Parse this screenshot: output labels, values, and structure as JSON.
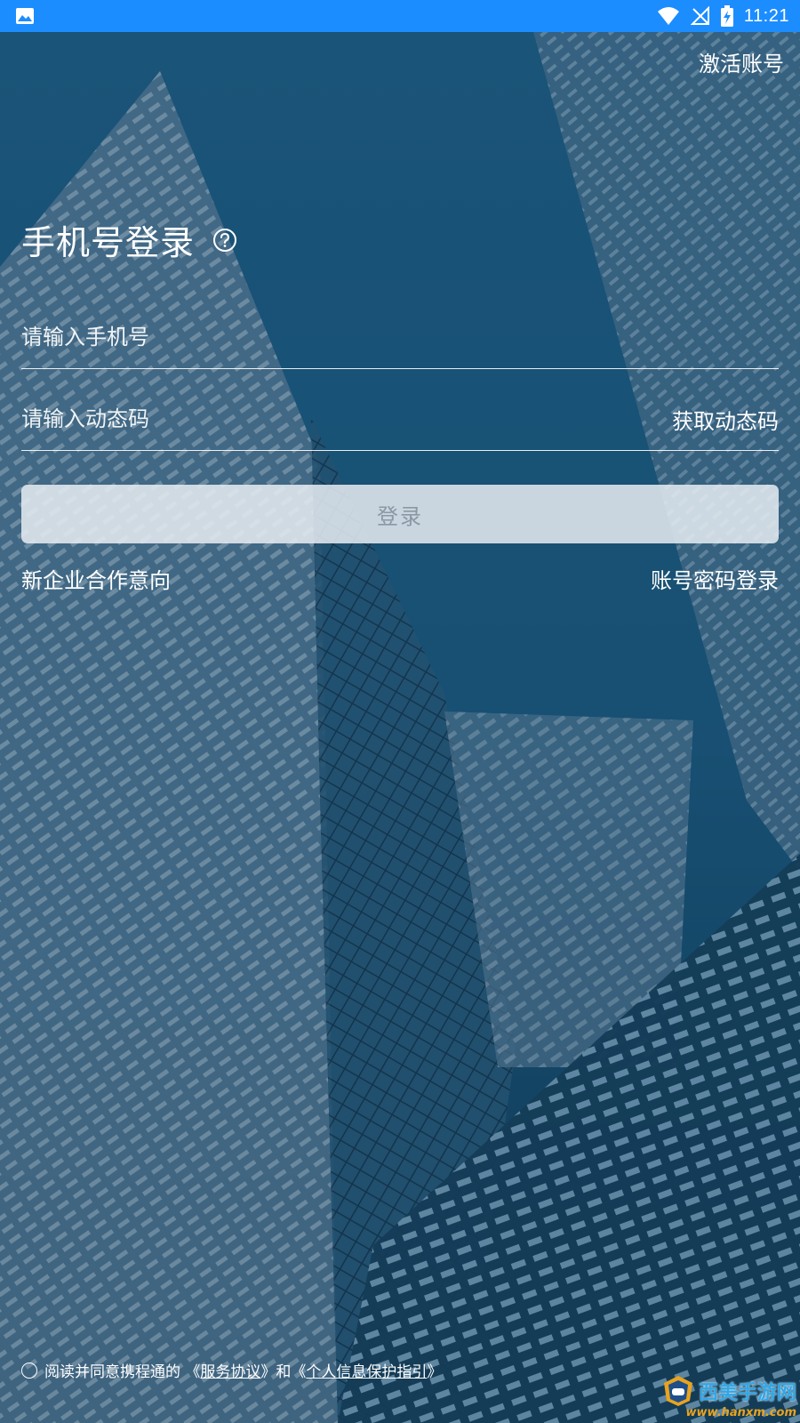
{
  "status_bar": {
    "time": "11:21"
  },
  "header": {
    "activate_label": "激活账号"
  },
  "login": {
    "title": "手机号登录",
    "phone_placeholder": "请输入手机号",
    "code_placeholder": "请输入动态码",
    "get_code_label": "获取动态码",
    "login_button": "登录",
    "new_enterprise_label": "新企业合作意向",
    "password_login_label": "账号密码登录"
  },
  "agreement": {
    "prefix": "阅读并同意携程通的 《",
    "service_link": "服务协议",
    "middle": "》和《",
    "privacy_link": "个人信息保护指引",
    "suffix": "》"
  },
  "watermark": {
    "name": "西美手游网",
    "url": "www.hanxm.com"
  },
  "icons": {
    "status_left": "image-icon",
    "wifi": "wifi-icon",
    "signal": "no-signal-icon",
    "battery": "battery-charging-icon",
    "help": "help-icon",
    "radio": "radio-unchecked-icon"
  },
  "colors": {
    "status_bar": "#1c8dff",
    "button_bg": "#e6ecf2",
    "button_text": "#8b97a3"
  }
}
